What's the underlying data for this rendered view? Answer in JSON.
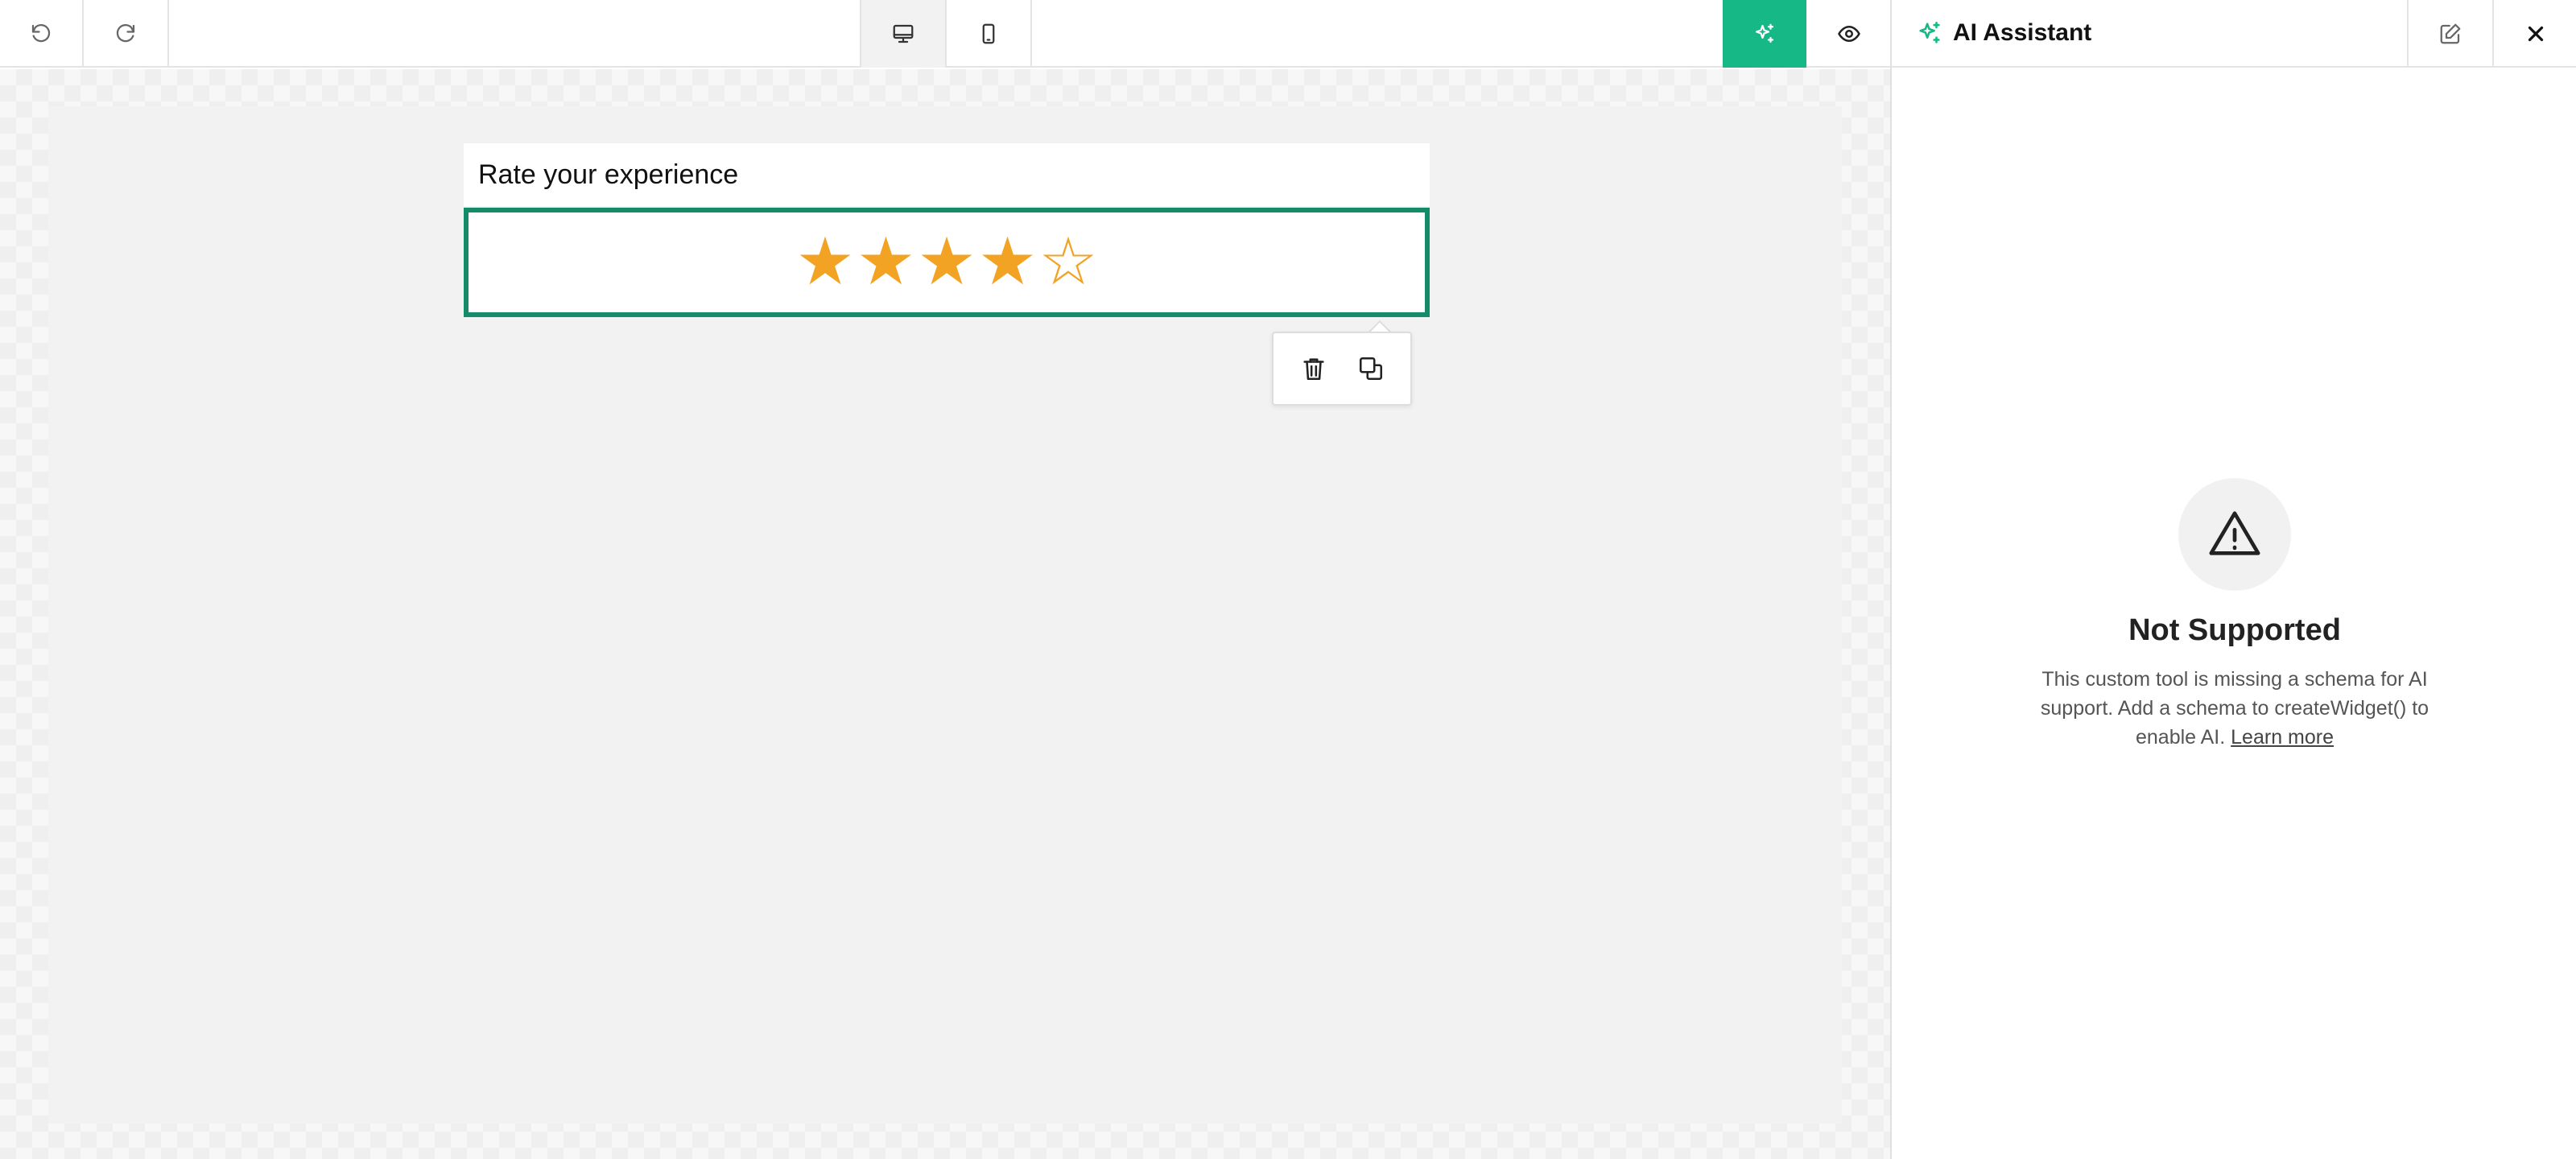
{
  "toolbar": {
    "undo_icon": "undo-icon",
    "redo_icon": "redo-icon",
    "desktop_icon": "desktop-icon",
    "mobile_icon": "mobile-icon",
    "ai_icon": "sparkles-icon",
    "preview_icon": "eye-icon",
    "accent_color": "#16b886"
  },
  "canvas": {
    "form_title": "Rate your experience",
    "rating": {
      "filled": 4,
      "total": 5,
      "star_color": "#f2a324"
    },
    "selection_color": "#148c6a",
    "popover": {
      "delete_icon": "trash-icon",
      "duplicate_icon": "duplicate-icon"
    }
  },
  "ai_panel": {
    "title": "AI Assistant",
    "edit_icon": "edit-icon",
    "close_icon": "close-icon",
    "status_icon": "warning-icon",
    "status_title": "Not Supported",
    "status_text": "This custom tool is missing a schema for AI support. Add a schema to createWidget() to enable AI.",
    "learn_more": "Learn more"
  }
}
